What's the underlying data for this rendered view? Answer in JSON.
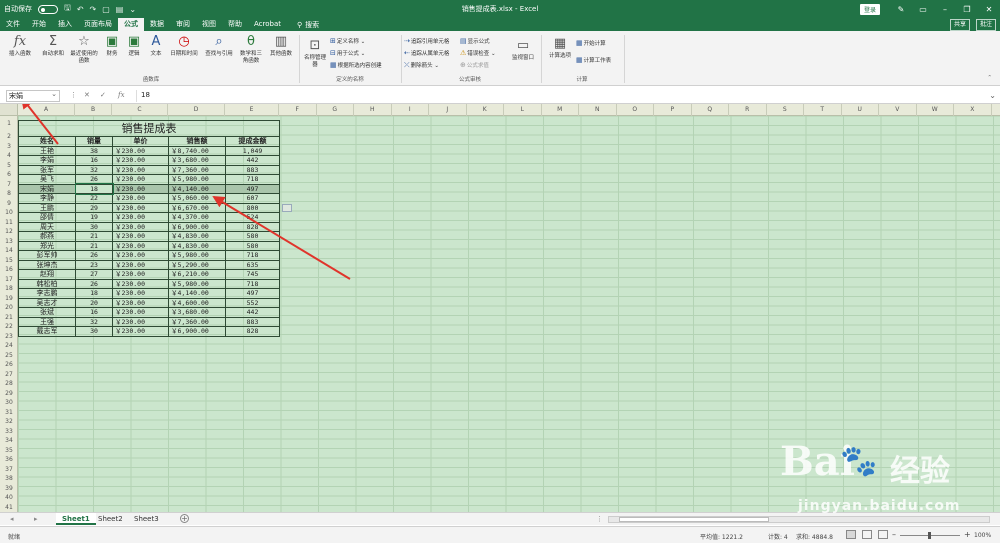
{
  "titlebar": {
    "autosave_label": "自动保存",
    "autosave_state": "关",
    "file_title": "销售提成表.xlsx - Excel",
    "login": "登录"
  },
  "menu": {
    "items": [
      "文件",
      "开始",
      "插入",
      "页面布局",
      "公式",
      "数据",
      "审阅",
      "视图",
      "帮助",
      "Acrobat"
    ],
    "active": "公式",
    "search": "搜索",
    "share": "共享",
    "comment": "批注"
  },
  "ribbon": {
    "insert_function": "插入函数",
    "autosum": "自动求和",
    "recent": "最近使用的函数",
    "financial": "财务",
    "logical": "逻辑",
    "text": "文本",
    "datetime": "日期和时间",
    "lookup": "查找与引用",
    "math": "数学和三角函数",
    "more": "其他函数",
    "group_library": "函数库",
    "name_manager": "名称管理器",
    "define_name": "定义名称",
    "use_in_formula": "用于公式",
    "create_from_sel": "根据所选内容创建",
    "group_names": "定义的名称",
    "trace_precedents": "追踪引用单元格",
    "trace_dependents": "追踪从属单元格",
    "remove_arrows": "删除箭头",
    "show_formulas": "显示公式",
    "error_checking": "错误检查",
    "evaluate": "公式求值",
    "watch": "监视窗口",
    "group_audit": "公式审核",
    "calc_options": "计算选项",
    "calc_now": "开始计算",
    "calc_sheet": "计算工作表",
    "group_calc": "计算"
  },
  "formula_bar": {
    "name_box": "宋娟",
    "fx": "fx",
    "value": "18"
  },
  "columns": [
    "A",
    "B",
    "C",
    "D",
    "E",
    "F",
    "G",
    "H",
    "I",
    "J",
    "K",
    "L",
    "M",
    "N",
    "O",
    "P",
    "Q",
    "R",
    "S",
    "T",
    "U",
    "V",
    "W",
    "X"
  ],
  "rows": [
    "1",
    "2",
    "3",
    "4",
    "5",
    "6",
    "7",
    "8",
    "9",
    "10",
    "11",
    "12",
    "13",
    "14",
    "15",
    "16",
    "17",
    "18",
    "19",
    "20",
    "21",
    "22",
    "23",
    "24",
    "25",
    "26",
    "27",
    "28",
    "29",
    "30",
    "31",
    "32",
    "33",
    "34",
    "35",
    "36",
    "37",
    "38",
    "39",
    "40",
    "41"
  ],
  "sheet": {
    "title": "销售提成表",
    "headers": [
      "姓名",
      "销量",
      "单价",
      "销售额",
      "提成金额"
    ],
    "rows": [
      [
        "王艳",
        "38",
        "￥230.00",
        "￥8,740.00",
        "1,049"
      ],
      [
        "李娟",
        "16",
        "￥230.00",
        "￥3,680.00",
        "442"
      ],
      [
        "张军",
        "32",
        "￥230.00",
        "￥7,360.00",
        "883"
      ],
      [
        "吴飞",
        "26",
        "￥230.00",
        "￥5,980.00",
        "718"
      ],
      [
        "宋娟",
        "18",
        "￥230.00",
        "￥4,140.00",
        "497"
      ],
      [
        "李静",
        "22",
        "￥230.00",
        "￥5,060.00",
        "607"
      ],
      [
        "王鹏",
        "29",
        "￥230.00",
        "￥6,670.00",
        "800"
      ],
      [
        "邵倩",
        "19",
        "￥230.00",
        "￥4,370.00",
        "524"
      ],
      [
        "周天",
        "30",
        "￥230.00",
        "￥6,900.00",
        "828"
      ],
      [
        "郝燕",
        "21",
        "￥230.00",
        "￥4,830.00",
        "580"
      ],
      [
        "郑光",
        "21",
        "￥230.00",
        "￥4,830.00",
        "580"
      ],
      [
        "彭军帅",
        "26",
        "￥230.00",
        "￥5,980.00",
        "718"
      ],
      [
        "张坤杰",
        "23",
        "￥230.00",
        "￥5,290.00",
        "635"
      ],
      [
        "赵翔",
        "27",
        "￥230.00",
        "￥6,210.00",
        "745"
      ],
      [
        "韩松柏",
        "26",
        "￥230.00",
        "￥5,980.00",
        "718"
      ],
      [
        "李志鹏",
        "18",
        "￥230.00",
        "￥4,140.00",
        "497"
      ],
      [
        "吴志才",
        "20",
        "￥230.00",
        "￥4,600.00",
        "552"
      ],
      [
        "张斌",
        "16",
        "￥230.00",
        "￥3,680.00",
        "442"
      ],
      [
        "王强",
        "32",
        "￥230.00",
        "￥7,360.00",
        "883"
      ],
      [
        "戴志军",
        "30",
        "￥230.00",
        "￥6,900.00",
        "828"
      ]
    ]
  },
  "tabs": [
    "Sheet1",
    "Sheet2",
    "Sheet3"
  ],
  "active_tab": "Sheet1",
  "status": {
    "ready": "就绪",
    "average": "平均值: 1221.2",
    "count": "计数: 4",
    "sum": "求和: 4884.8",
    "zoom": "100%"
  },
  "watermark": {
    "brand": "Bai",
    "brand_cn": "经验",
    "url": "jingyan.baidu.com"
  },
  "colors": {
    "excel_green": "#217346",
    "cell_bg": "#cbe6cd",
    "arrow": "#e0342b"
  }
}
